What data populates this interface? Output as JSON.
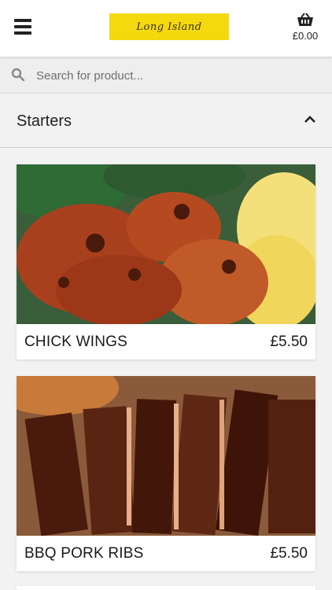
{
  "header": {
    "logo_text": "Long Island",
    "basket_total": "£0.00"
  },
  "search": {
    "placeholder": "Search for product..."
  },
  "category": {
    "title": "Starters"
  },
  "products": [
    {
      "name": "CHICK WINGS",
      "price": "£5.50"
    },
    {
      "name": "BBQ PORK RIBS",
      "price": "£5.50"
    }
  ],
  "colors": {
    "logo_background": "#f5d90f",
    "page_background": "#f2f2f2",
    "header_background": "#ffffff"
  }
}
